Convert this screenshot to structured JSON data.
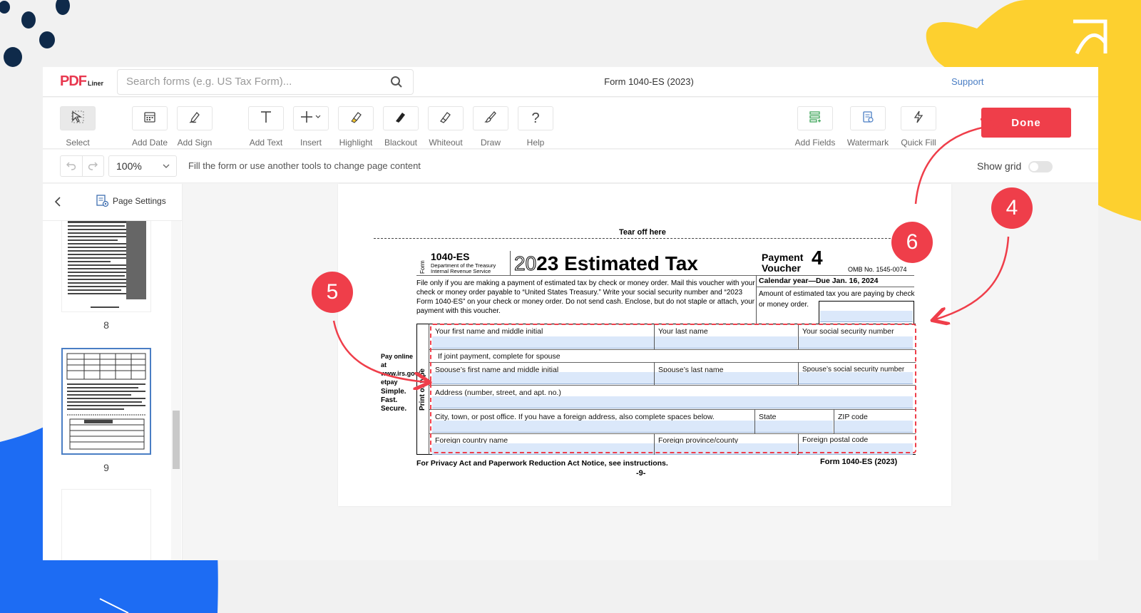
{
  "header": {
    "logo_main": "PDF",
    "logo_sub": "Liner",
    "search_placeholder": "Search forms (e.g. US Tax Form)...",
    "document_title": "Form 1040-ES (2023)",
    "support_label": "Support"
  },
  "toolbar": {
    "tools": [
      {
        "label": "Select",
        "icon": "cursor-icon"
      },
      {
        "label": "Add Date",
        "icon": "calendar-icon"
      },
      {
        "label": "Add Sign",
        "icon": "pen-sign-icon"
      },
      {
        "label": "Add Text",
        "icon": "text-icon"
      },
      {
        "label": "Insert",
        "icon": "plus-icon"
      },
      {
        "label": "Highlight",
        "icon": "highlighter-icon"
      },
      {
        "label": "Blackout",
        "icon": "blackout-icon"
      },
      {
        "label": "Whiteout",
        "icon": "whiteout-icon"
      },
      {
        "label": "Draw",
        "icon": "brush-icon"
      },
      {
        "label": "Help",
        "icon": "question-icon"
      }
    ],
    "right_tools": [
      {
        "label": "Add Fields",
        "icon": "add-fields-icon"
      },
      {
        "label": "Watermark",
        "icon": "watermark-icon"
      },
      {
        "label": "Quick Fill",
        "icon": "lightning-icon"
      }
    ],
    "done_label": "Done",
    "accent_color": "#ef3e4a"
  },
  "subbar": {
    "zoom": "100%",
    "hint": "Fill the form or use another tools to change page content",
    "show_grid_label": "Show grid",
    "show_grid_on": false
  },
  "sidebar": {
    "settings_label": "Page Settings",
    "pages": [
      "8",
      "9"
    ],
    "active_page": "9"
  },
  "form": {
    "tear_off": "Tear off here",
    "form_word": "Form",
    "form_number": "1040-ES",
    "dept": "Department of the Treasury",
    "irs": "Internal Revenue Service",
    "year_light": "20",
    "year_bold": "23",
    "title": "Estimated Tax",
    "voucher_label": "Payment Voucher",
    "voucher_number": "4",
    "omb": "OMB No. 1545-0074",
    "instructions": "File only if you are making a payment of estimated tax by check or money order. Mail this voucher with your check or money order payable to “United States Treasury.” Write your social security number and “2023 Form 1040-ES” on your check or money order. Do not send cash. Enclose, but do not staple or attach, your payment with this voucher.",
    "due_line": "Calendar year—Due Jan. 16, 2024",
    "amount_label": "Amount of estimated tax you are paying by check or money order.",
    "pay_online": "Pay online at www.irs.gov/ etpay",
    "simple": "Simple. Fast. Secure.",
    "print_or_type": "Print or type",
    "labels": {
      "first_name": "Your first name and middle initial",
      "last_name": "Your last name",
      "ssn": "Your social security number",
      "joint": "If joint payment, complete for spouse",
      "spouse_first": "Spouse’s first name and middle initial",
      "spouse_last": "Spouse’s last name",
      "spouse_ssn": "Spouse’s social security number",
      "address": "Address (number, street, and apt. no.)",
      "city": "City, town, or post office. If you have a foreign address, also complete spaces below.",
      "state": "State",
      "zip": "ZIP code",
      "foreign_country": "Foreign country name",
      "foreign_province": "Foreign province/county",
      "foreign_postal": "Foreign postal code"
    },
    "footer_left": "For Privacy Act and Paperwork Reduction Act Notice, see instructions.",
    "footer_right": "Form 1040-ES (2023)",
    "page_number": "-9-"
  },
  "callouts": [
    "4",
    "5",
    "6"
  ],
  "colors": {
    "callout_red": "#ef3e4a",
    "deco_yellow": "#fdd02f",
    "deco_blue": "#1d6cf3",
    "deco_navy": "#0f2a4a",
    "field_blue": "#dbe8fa",
    "link_blue": "#4a7ec4"
  }
}
